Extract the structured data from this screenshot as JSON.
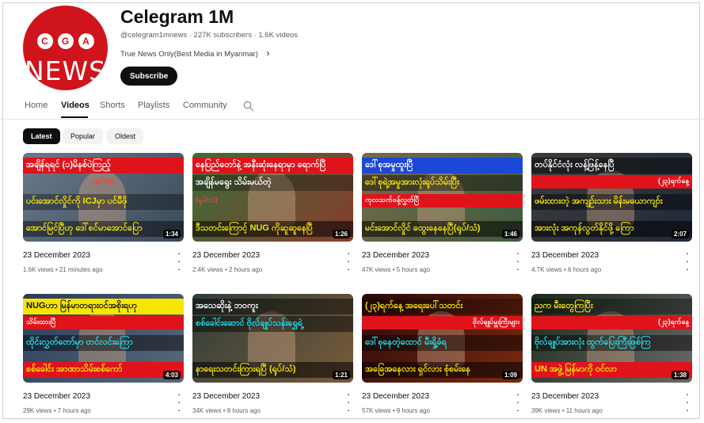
{
  "channel": {
    "avatar_letters": [
      "C",
      "G",
      "A"
    ],
    "avatar_word": "NEWS",
    "name": "Celegram 1M",
    "handle": "@celegram1mnews",
    "subscribers": "227K subscribers",
    "video_count": "1.6K videos",
    "description": "True News Only(Best Media in Myanmar)",
    "subscribe_label": "Subscribe"
  },
  "tabs": [
    "Home",
    "Videos",
    "Shorts",
    "Playlists",
    "Community"
  ],
  "active_tab": "Videos",
  "filters": [
    "Latest",
    "Popular",
    "Oldest"
  ],
  "active_filter": "Latest",
  "colors": {
    "brand_red": "#d0141c",
    "banner_yellow": "#f7e600",
    "banner_cyan": "#1ee0f0",
    "banner_red": "#e0131b"
  },
  "videos": [
    {
      "date": "23 December 2023",
      "views": "1.6K views",
      "ago": "21 minutes ago",
      "duration": "1:34",
      "banners": [
        "အချိန်ရရင် (၁)မိနစ်ပဲကြည့်",
        "(ရုပ်/သံ)",
        "ပင်းအောင်လှိုင်ကို ICJမှာ ပင်မီဖို",
        "အောင်မြင်ပြီဟု ဒေါ်စင်မာအောင်ပြော"
      ]
    },
    {
      "date": "23 December 2023",
      "views": "2.4K views",
      "ago": "2 hours ago",
      "duration": "1:26",
      "banners": [
        "နေပြည်တော်နဲ့ အနီးဆုံးနေရာမှာ ရောက်ပြီ",
        "အချိန်မရွေး သိမ်းမယ်တဲ့",
        "(ရုပ်/သံ)",
        "ဒီသတင်းကြောင့် NUG ကိုဆူဆူနေပြီ"
      ]
    },
    {
      "date": "23 December 2023",
      "views": "47K views",
      "ago": "5 hours ago",
      "duration": "1:46",
      "banners": [
        "ဒေါ်စုအမှုထူးပြီ",
        "ဒေါ်စုရဲ့အမှုအားလုံးရုပ်သိမ်းပြီး",
        "ကုလသက်ဖန့်လွှတ်ပြီ",
        "မင်းအောင်လှိုင် ထွေးနေနေပြီ(ရုပ်/သံ)"
      ]
    },
    {
      "date": "23 December 2023",
      "views": "4.7K views",
      "ago": "6 hours ago",
      "duration": "2:07",
      "banners": [
        "တပ်နိုင်ငံလုံး လန့်ဖြန့်နေပြီ",
        "(၂၃)ရက်နေ့",
        "ဖမ်းထားတဲ့ အကျဉ်းသား မိန်းမယောကျာ်း",
        "အားလုံး အကုန်လွတ်နိုင်ဖို့ ကြော"
      ]
    },
    {
      "date": "23 December 2023",
      "views": "29K views",
      "ago": "7 hours ago",
      "duration": "4:03",
      "banners": [
        "NUGဟာ မြန်မာတရားဝင်အစိုးရဟု",
        "သိမ်းထားပြီ",
        "ထိုင်းလွှတ်တော်မှာ တင်လင်းကြော",
        "စစ်ခေါင်း အာဏာသိမ်းစစ်ကော်"
      ]
    },
    {
      "date": "23 December 2023",
      "views": "34K views",
      "ago": "8 hours ago",
      "duration": "1:21",
      "banners": [
        "အသေဆိုးနဲ့ ဘဝကူး",
        "စစ်ခေါင်းဆောင် ဗိုလ်ချုပ်သန်းရွှေရဲ့",
        "",
        "နာရေးသတင်းကြားရပြီ (ရုပ်/သံ)"
      ]
    },
    {
      "date": "23 December 2023",
      "views": "57K views",
      "ago": "9 hours ago",
      "duration": "1:09",
      "banners": [
        "(၂၃)ရက်နေ့ အရေးပေါ်သတင်း",
        "ဗိုလ်ချုပ်မှူးကြီးများ",
        "ဒေါ်စုနေတဲ့ထောင် မီးရှို့ခံရ",
        "အခြေအနေလား ရှင်လား စုံစမ်းနေ"
      ]
    },
    {
      "date": "23 December 2023",
      "views": "39K views",
      "ago": "11 hours ago",
      "duration": "1:38",
      "banners": [
        "ညက မီးတွေကြပြီး",
        "(၂၃)ရက်နေ့",
        "ဗိုလ်ချုပ်အားလုံး ထွက်ပြေးကြီးဖြစ်ကြ",
        "UN အဖွဲ့ မြန်မာကို ဝင်လာ"
      ]
    }
  ]
}
